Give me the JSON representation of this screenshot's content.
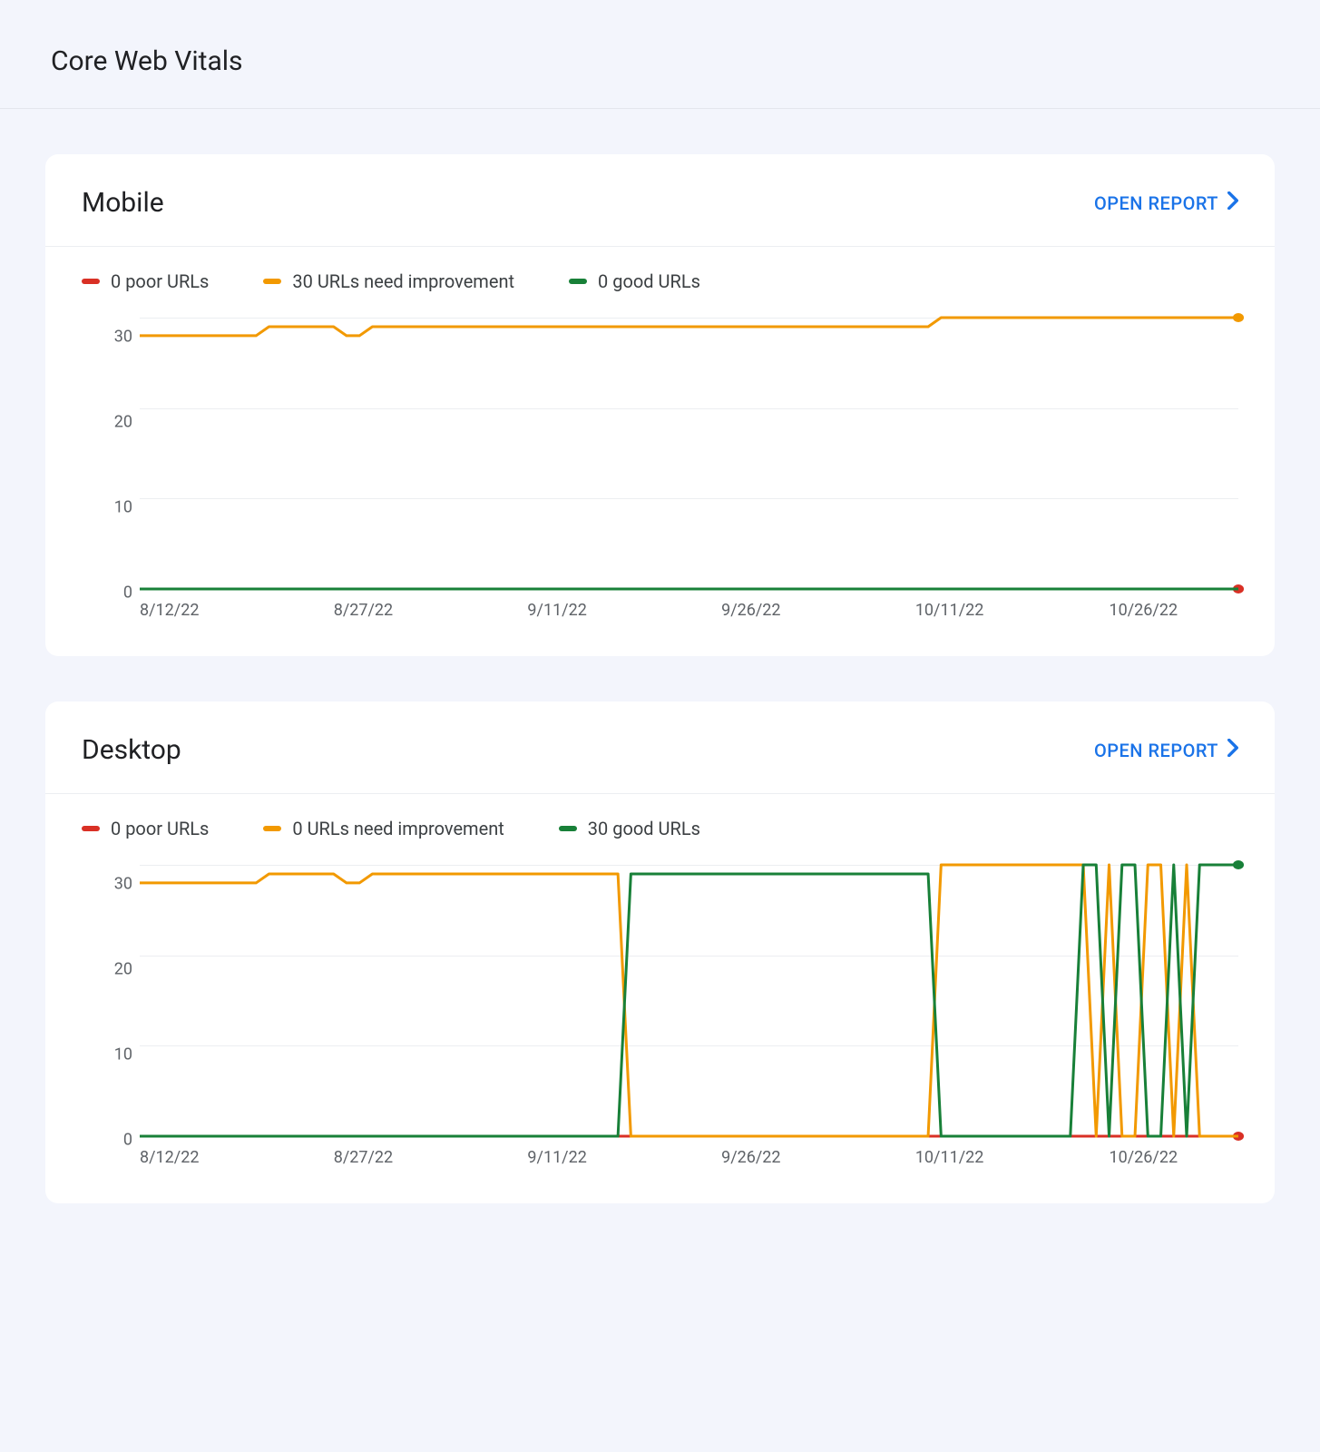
{
  "page": {
    "title": "Core Web Vitals",
    "open_report_label": "OPEN REPORT"
  },
  "colors": {
    "poor": "#d93025",
    "needs": "#f29900",
    "good": "#188038",
    "grid": "#eceef1",
    "axis": "#dadce0"
  },
  "x_labels": [
    "8/12/22",
    "8/27/22",
    "9/11/22",
    "9/26/22",
    "10/11/22",
    "10/26/22"
  ],
  "y_ticks": [
    30,
    20,
    10,
    0
  ],
  "cards": [
    {
      "id": "mobile",
      "title": "Mobile",
      "legend": {
        "poor": "0 poor URLs",
        "needs": "30 URLs need improvement",
        "good": "0 good URLs"
      }
    },
    {
      "id": "desktop",
      "title": "Desktop",
      "legend": {
        "poor": "0 poor URLs",
        "needs": "0 URLs need improvement",
        "good": "30 good URLs"
      }
    }
  ],
  "chart_data": [
    {
      "panel": "Mobile",
      "type": "line",
      "xlabel": "",
      "ylabel": "",
      "ylim": [
        0,
        30
      ],
      "x_dates": [
        "8/12/22",
        "8/27/22",
        "9/11/22",
        "9/26/22",
        "10/11/22",
        "10/26/22"
      ],
      "x": [
        0,
        1,
        2,
        3,
        4,
        5,
        6,
        7,
        8,
        9,
        10,
        11,
        12,
        13,
        14,
        15,
        16,
        17,
        18,
        19,
        20,
        21,
        22,
        23,
        24,
        25,
        26,
        27,
        28,
        29,
        30,
        31,
        32,
        33,
        34,
        35,
        36,
        37,
        38,
        39,
        40,
        41,
        42,
        43,
        44,
        45,
        46,
        47,
        48,
        49,
        50,
        51,
        52,
        53,
        54,
        55,
        56,
        57,
        58,
        59,
        60,
        61,
        62,
        63,
        64,
        65,
        66,
        67,
        68,
        69,
        70,
        71,
        72,
        73,
        74,
        75,
        76,
        77,
        78,
        79,
        80,
        81,
        82,
        83,
        84,
        85
      ],
      "series": [
        {
          "name": "poor URLs",
          "values": [
            0,
            0,
            0,
            0,
            0,
            0,
            0,
            0,
            0,
            0,
            0,
            0,
            0,
            0,
            0,
            0,
            0,
            0,
            0,
            0,
            0,
            0,
            0,
            0,
            0,
            0,
            0,
            0,
            0,
            0,
            0,
            0,
            0,
            0,
            0,
            0,
            0,
            0,
            0,
            0,
            0,
            0,
            0,
            0,
            0,
            0,
            0,
            0,
            0,
            0,
            0,
            0,
            0,
            0,
            0,
            0,
            0,
            0,
            0,
            0,
            0,
            0,
            0,
            0,
            0,
            0,
            0,
            0,
            0,
            0,
            0,
            0,
            0,
            0,
            0,
            0,
            0,
            0,
            0,
            0,
            0,
            0,
            0,
            0,
            0,
            0
          ],
          "color": "poor",
          "end_marker": true
        },
        {
          "name": "URLs need improvement",
          "values": [
            28,
            28,
            28,
            28,
            28,
            28,
            28,
            28,
            28,
            28,
            29,
            29,
            29,
            29,
            29,
            29,
            28,
            28,
            29,
            29,
            29,
            29,
            29,
            29,
            29,
            29,
            29,
            29,
            29,
            29,
            29,
            29,
            29,
            29,
            29,
            29,
            29,
            29,
            29,
            29,
            29,
            29,
            29,
            29,
            29,
            29,
            29,
            29,
            29,
            29,
            29,
            29,
            29,
            29,
            29,
            29,
            29,
            29,
            29,
            29,
            29,
            29,
            30,
            30,
            30,
            30,
            30,
            30,
            30,
            30,
            30,
            30,
            30,
            30,
            30,
            30,
            30,
            30,
            30,
            30,
            30,
            30,
            30,
            30,
            30,
            30
          ],
          "color": "needs",
          "end_marker": true
        },
        {
          "name": "good URLs",
          "values": [
            0,
            0,
            0,
            0,
            0,
            0,
            0,
            0,
            0,
            0,
            0,
            0,
            0,
            0,
            0,
            0,
            0,
            0,
            0,
            0,
            0,
            0,
            0,
            0,
            0,
            0,
            0,
            0,
            0,
            0,
            0,
            0,
            0,
            0,
            0,
            0,
            0,
            0,
            0,
            0,
            0,
            0,
            0,
            0,
            0,
            0,
            0,
            0,
            0,
            0,
            0,
            0,
            0,
            0,
            0,
            0,
            0,
            0,
            0,
            0,
            0,
            0,
            0,
            0,
            0,
            0,
            0,
            0,
            0,
            0,
            0,
            0,
            0,
            0,
            0,
            0,
            0,
            0,
            0,
            0,
            0,
            0,
            0,
            0,
            0,
            0
          ],
          "color": "good",
          "end_marker": false
        }
      ]
    },
    {
      "panel": "Desktop",
      "type": "line",
      "xlabel": "",
      "ylabel": "",
      "ylim": [
        0,
        30
      ],
      "x_dates": [
        "8/12/22",
        "8/27/22",
        "9/11/22",
        "9/26/22",
        "10/11/22",
        "10/26/22"
      ],
      "x": [
        0,
        1,
        2,
        3,
        4,
        5,
        6,
        7,
        8,
        9,
        10,
        11,
        12,
        13,
        14,
        15,
        16,
        17,
        18,
        19,
        20,
        21,
        22,
        23,
        24,
        25,
        26,
        27,
        28,
        29,
        30,
        31,
        32,
        33,
        34,
        35,
        36,
        37,
        38,
        39,
        40,
        41,
        42,
        43,
        44,
        45,
        46,
        47,
        48,
        49,
        50,
        51,
        52,
        53,
        54,
        55,
        56,
        57,
        58,
        59,
        60,
        61,
        62,
        63,
        64,
        65,
        66,
        67,
        68,
        69,
        70,
        71,
        72,
        73,
        74,
        75,
        76,
        77,
        78,
        79,
        80,
        81,
        82,
        83,
        84,
        85
      ],
      "series": [
        {
          "name": "poor URLs",
          "values": [
            0,
            0,
            0,
            0,
            0,
            0,
            0,
            0,
            0,
            0,
            0,
            0,
            0,
            0,
            0,
            0,
            0,
            0,
            0,
            0,
            0,
            0,
            0,
            0,
            0,
            0,
            0,
            0,
            0,
            0,
            0,
            0,
            0,
            0,
            0,
            0,
            0,
            0,
            0,
            0,
            0,
            0,
            0,
            0,
            0,
            0,
            0,
            0,
            0,
            0,
            0,
            0,
            0,
            0,
            0,
            0,
            0,
            0,
            0,
            0,
            0,
            0,
            0,
            0,
            0,
            0,
            0,
            0,
            0,
            0,
            0,
            0,
            0,
            0,
            0,
            0,
            0,
            0,
            0,
            0,
            0,
            0,
            0,
            0,
            0,
            0
          ],
          "color": "poor",
          "end_marker": true
        },
        {
          "name": "URLs need improvement",
          "values": [
            28,
            28,
            28,
            28,
            28,
            28,
            28,
            28,
            28,
            28,
            29,
            29,
            29,
            29,
            29,
            29,
            28,
            28,
            29,
            29,
            29,
            29,
            29,
            29,
            29,
            29,
            29,
            29,
            29,
            29,
            29,
            29,
            29,
            29,
            29,
            29,
            29,
            29,
            0,
            0,
            0,
            0,
            0,
            0,
            0,
            0,
            0,
            0,
            0,
            0,
            0,
            0,
            0,
            0,
            0,
            0,
            0,
            0,
            0,
            0,
            0,
            0,
            30,
            30,
            30,
            30,
            30,
            30,
            30,
            30,
            30,
            30,
            30,
            30,
            0,
            30,
            0,
            0,
            30,
            30,
            0,
            30,
            0,
            0,
            0,
            0
          ],
          "color": "needs",
          "end_marker": false
        },
        {
          "name": "good URLs",
          "values": [
            0,
            0,
            0,
            0,
            0,
            0,
            0,
            0,
            0,
            0,
            0,
            0,
            0,
            0,
            0,
            0,
            0,
            0,
            0,
            0,
            0,
            0,
            0,
            0,
            0,
            0,
            0,
            0,
            0,
            0,
            0,
            0,
            0,
            0,
            0,
            0,
            0,
            0,
            29,
            29,
            29,
            29,
            29,
            29,
            29,
            29,
            29,
            29,
            29,
            29,
            29,
            29,
            29,
            29,
            29,
            29,
            29,
            29,
            29,
            29,
            29,
            29,
            0,
            0,
            0,
            0,
            0,
            0,
            0,
            0,
            0,
            0,
            0,
            30,
            30,
            0,
            30,
            30,
            0,
            0,
            30,
            0,
            30,
            30,
            30,
            30
          ],
          "color": "good",
          "end_marker": true
        }
      ]
    }
  ]
}
